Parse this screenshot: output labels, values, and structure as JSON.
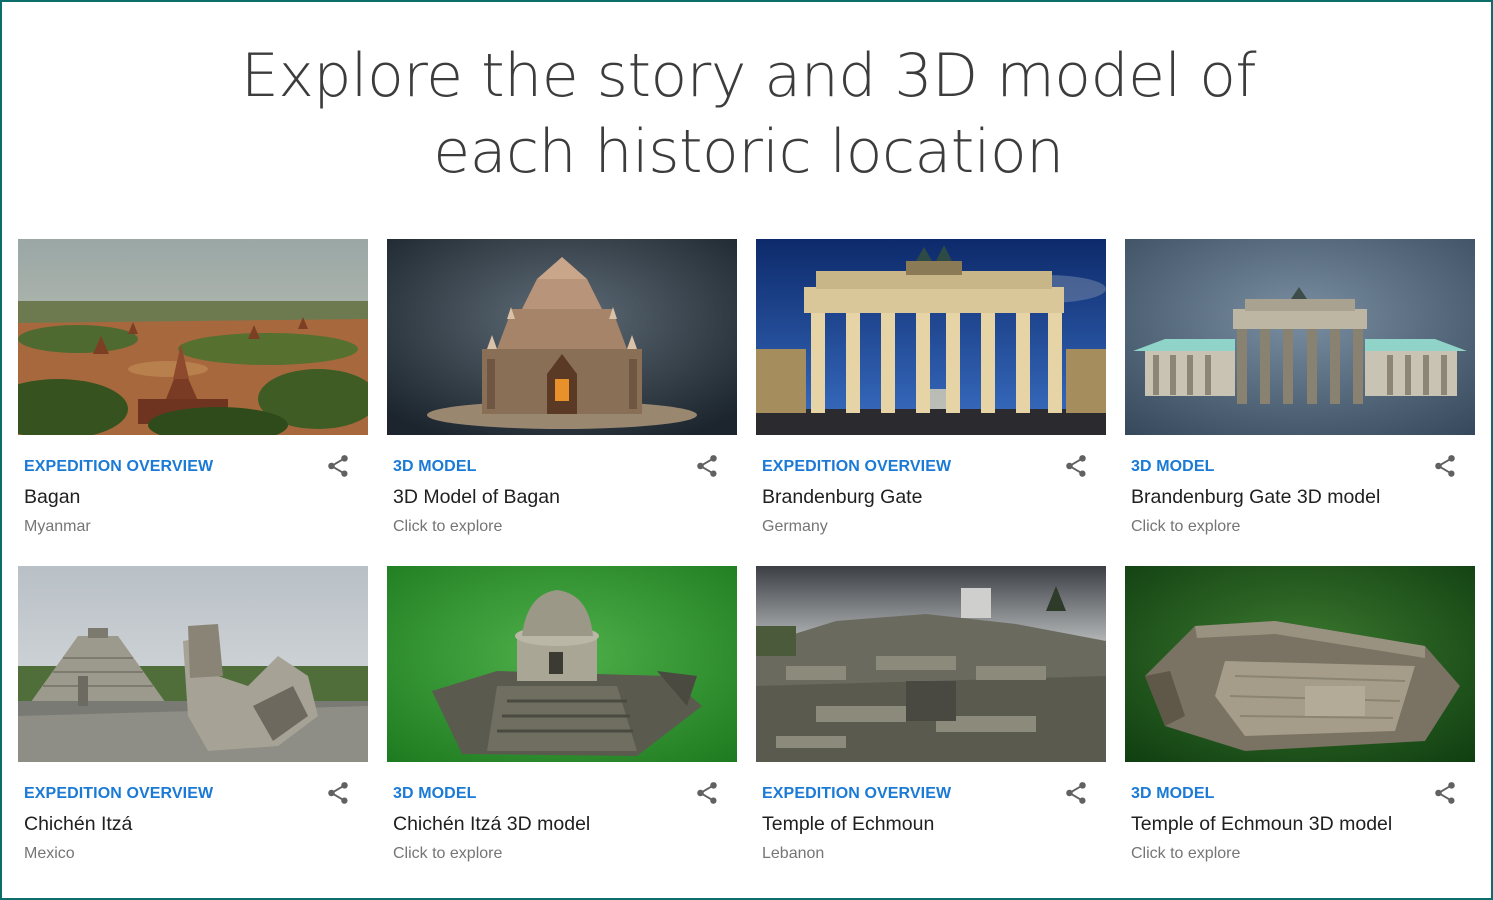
{
  "page": {
    "title": "Explore the story and 3D model of\neach historic location"
  },
  "colors": {
    "accent": "#1a7ad6",
    "border": "#0b6e6a"
  },
  "cards": [
    {
      "kind": "EXPEDITION OVERVIEW",
      "title": "Bagan",
      "subtitle": "Myanmar",
      "share_icon": "share-icon",
      "image": "bagan-landscape-photo"
    },
    {
      "kind": "3D MODEL",
      "title": "3D Model of Bagan",
      "subtitle": "Click to explore",
      "share_icon": "share-icon",
      "image": "bagan-temple-3d-render"
    },
    {
      "kind": "EXPEDITION OVERVIEW",
      "title": "Brandenburg Gate",
      "subtitle": "Germany",
      "share_icon": "share-icon",
      "image": "brandenburg-gate-night-photo"
    },
    {
      "kind": "3D MODEL",
      "title": "Brandenburg Gate 3D model",
      "subtitle": "Click to explore",
      "share_icon": "share-icon",
      "image": "brandenburg-gate-3d-render"
    },
    {
      "kind": "EXPEDITION OVERVIEW",
      "title": "Chichén Itzá",
      "subtitle": "Mexico",
      "share_icon": "share-icon",
      "image": "chichen-itza-photo"
    },
    {
      "kind": "3D MODEL",
      "title": "Chichén Itzá 3D model",
      "subtitle": "Click to explore",
      "share_icon": "share-icon",
      "image": "chichen-itza-observatory-3d-render"
    },
    {
      "kind": "EXPEDITION OVERVIEW",
      "title": "Temple of Echmoun",
      "subtitle": "Lebanon",
      "share_icon": "share-icon",
      "image": "echmoun-ruins-photo"
    },
    {
      "kind": "3D MODEL",
      "title": "Temple of Echmoun 3D model",
      "subtitle": "Click to explore",
      "share_icon": "share-icon",
      "image": "echmoun-mosaic-3d-render"
    }
  ]
}
